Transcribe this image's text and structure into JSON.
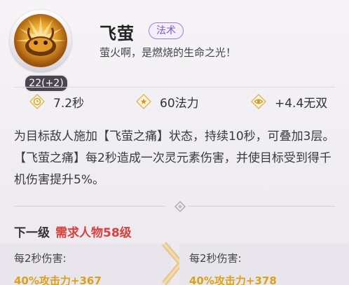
{
  "skill": {
    "name": "飞萤",
    "type_tag": "法术",
    "quote": "萤火啊，是燃烧的生命之光！",
    "level": "22(+2)"
  },
  "stats": [
    {
      "icon": "clock-icon",
      "value": "7.2秒"
    },
    {
      "icon": "star-icon",
      "value": "60法力"
    },
    {
      "icon": "eye-icon",
      "value": "+4.4无双"
    }
  ],
  "description": "为目标敌人施加【飞萤之痛】状态，持续10秒，可叠加3层。【飞萤之痛】每2秒造成一次灵元素伤害，并使目标受到得千机伤害提升5%。",
  "next_level": {
    "title": "下一级",
    "requirement": "需求人物58级",
    "current": {
      "label": "每2秒伤害:",
      "value": "40%攻击力+367"
    },
    "next": {
      "label": "每2秒伤害:",
      "value": "40%攻击力+378"
    }
  },
  "colors": {
    "accent_gold": "#d8a21c",
    "requirement_red": "#d6413d",
    "tag_purple": "#7a5cc0"
  }
}
